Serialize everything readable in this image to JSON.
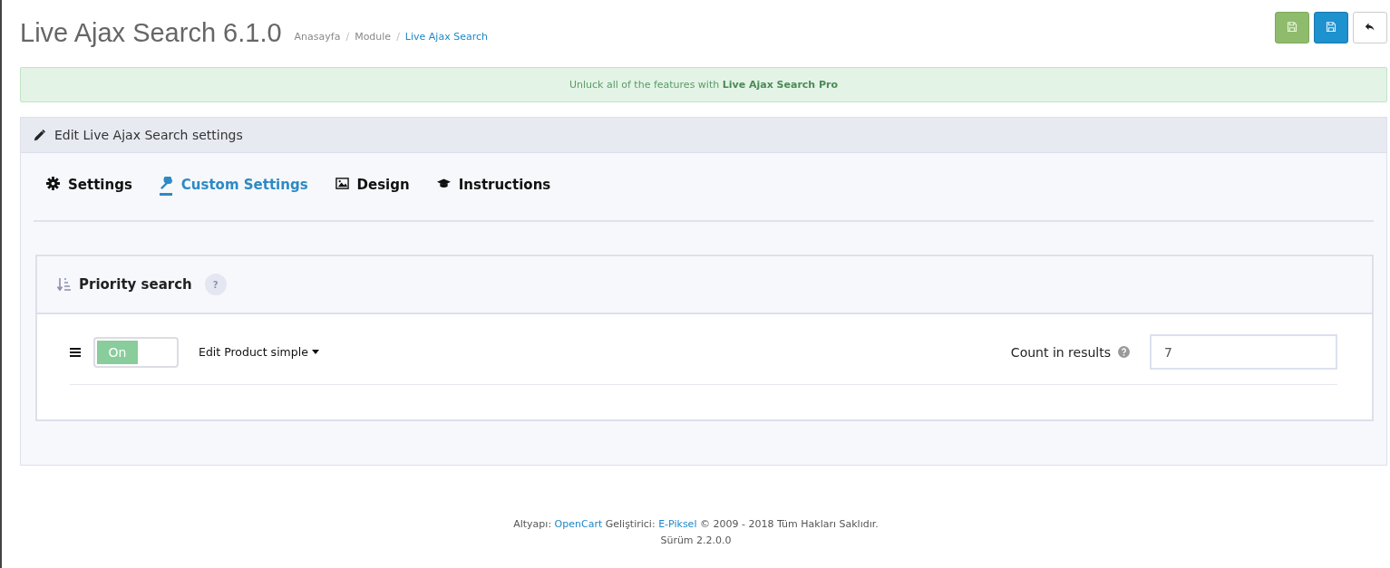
{
  "header": {
    "title": "Live Ajax Search 6.1.0",
    "breadcrumbs": [
      {
        "label": "Anasayfa",
        "current": false
      },
      {
        "separator": "/",
        "label": "Module",
        "current": false
      },
      {
        "separator": "/",
        "label": "Live Ajax Search",
        "current": true
      }
    ]
  },
  "toolbar": {
    "buttons": [
      {
        "kind": "save-stay"
      },
      {
        "kind": "save"
      },
      {
        "kind": "back"
      }
    ]
  },
  "alert": {
    "text": "Unluck all of the features with **Live Ajax Search Pro**"
  },
  "panel": {
    "title": "Edit Live Ajax Search settings",
    "tabs": [
      {
        "label": "Settings",
        "selected": false
      },
      {
        "label": "Custom Settings",
        "selected": true
      },
      {
        "label": "Design",
        "selected": false
      },
      {
        "label": "Instructions",
        "selected": false
      }
    ],
    "section": {
      "title": "Priority search",
      "help": "?",
      "row": {
        "toggle": {
          "label": "On",
          "on": true
        },
        "dropdown": "Edit Product simple",
        "count_label": "Count in results",
        "count_value": "7"
      }
    }
  },
  "footer": {
    "prefix": "Altyapı:",
    "link1": "OpenCart",
    "middle": "Geliştirici:",
    "link2": "E-Piksel",
    "suffix": "© 2009 - 2018 Tüm Hakları Saklıdır.",
    "line2": "Sürüm 2.2.0.0"
  }
}
